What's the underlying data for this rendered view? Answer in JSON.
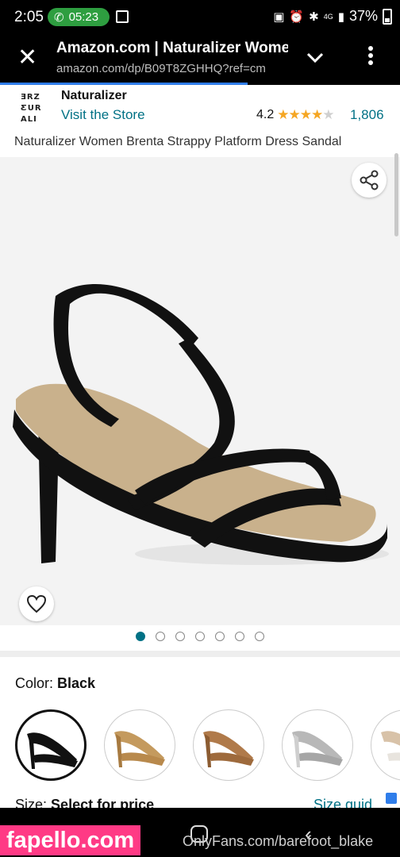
{
  "status_bar": {
    "time": "2:05",
    "call_timer": "05:23",
    "battery": "37%",
    "network": "4G"
  },
  "browser": {
    "title": "Amazon.com | Naturalizer Women",
    "url": "amazon.com/dp/B09T8ZGHHQ?ref=cm",
    "progress_fraction": 0.62
  },
  "store": {
    "logo_text": "NATURALIZER",
    "brand": "Naturalizer",
    "visit_link": "Visit the Store",
    "rating": "4.2",
    "stars_filled": 4.2,
    "review_count": "1,806"
  },
  "product": {
    "title": "Naturalizer Women Brenta Strappy Platform Dress Sandal",
    "image_count": 7,
    "active_image": 1
  },
  "color": {
    "label": "Color:",
    "value": "Black",
    "swatch_names": [
      "black-swatch",
      "gold-swatch",
      "tan-swatch",
      "silver-swatch",
      "white-swatch"
    ]
  },
  "size": {
    "label": "Size:",
    "value": "Select for price",
    "guide": "Size guid"
  },
  "watermarks": {
    "left": "fapello.com",
    "right": "OnlyFans.com/barefoot_blake"
  },
  "colors": {
    "link": "#007185",
    "star": "#f5a623",
    "call_pill": "#2e9e40",
    "watermark": "#ff3a85"
  }
}
